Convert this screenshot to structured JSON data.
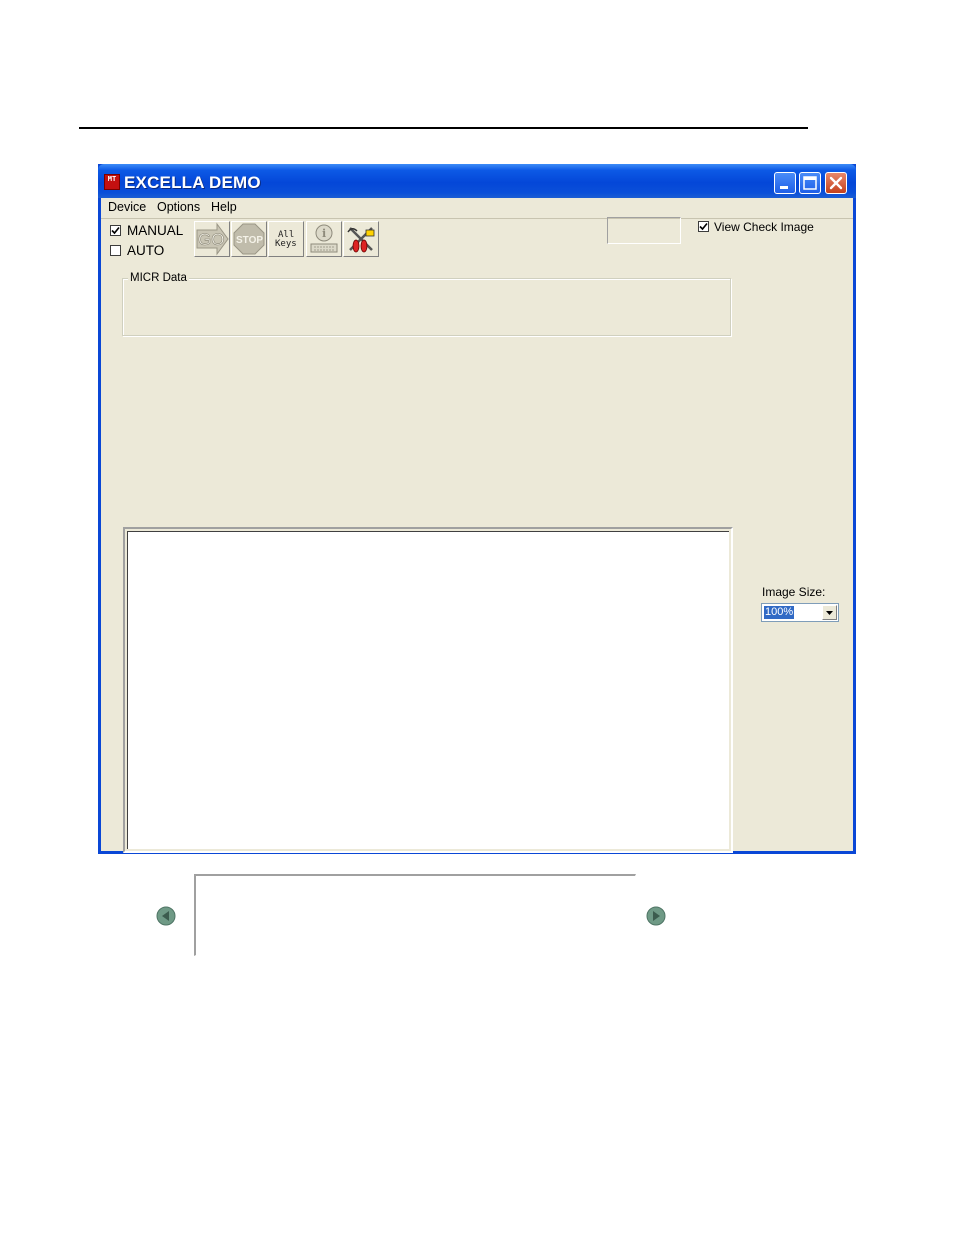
{
  "window": {
    "title": "EXCELLA DEMO",
    "logo_text": "MT"
  },
  "menu": {
    "items": [
      "Device",
      "Options",
      "Help"
    ]
  },
  "mode": {
    "manual_label": "MANUAL",
    "manual_checked": true,
    "auto_label": "AUTO",
    "auto_checked": false
  },
  "toolbar": {
    "go_label": "GO",
    "stop_label": "STOP",
    "all_keys_label": "All Keys",
    "info_icon": "info-keyboard-icon",
    "tools_icon": "tools-icon"
  },
  "view_check_image": {
    "label": "View Check Image",
    "checked": true
  },
  "micr": {
    "label": "MICR Data",
    "value": ""
  },
  "image_size": {
    "label": "Image Size:",
    "selected": "100%"
  },
  "colors": {
    "title_bar": "#0a47d6",
    "client_bg": "#ece9d8",
    "close_button": "#c4401c",
    "selection": "#316ac5"
  }
}
